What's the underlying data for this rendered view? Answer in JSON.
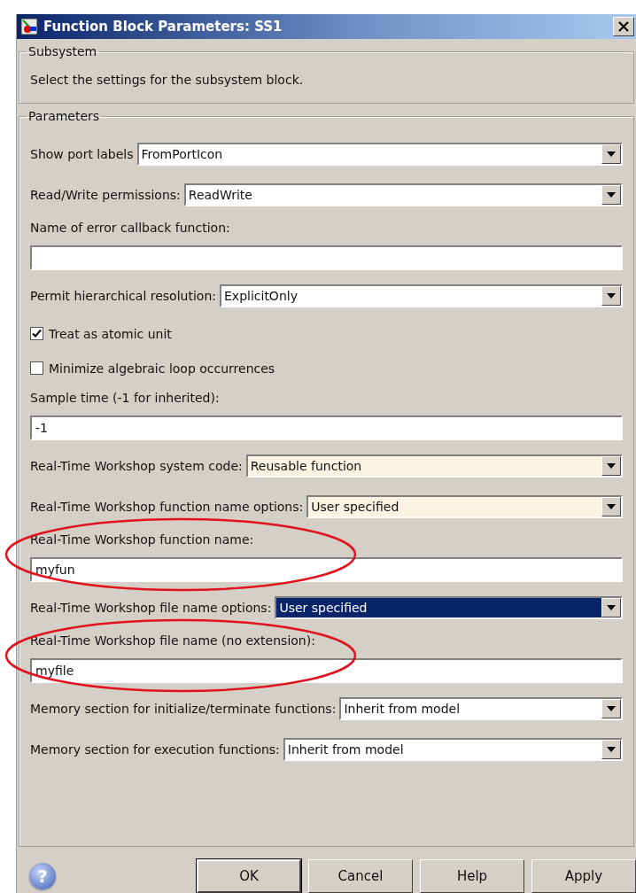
{
  "window": {
    "title": "Function Block Parameters: SS1"
  },
  "subsystem": {
    "legend": "Subsystem",
    "description": "Select the settings for the subsystem block."
  },
  "parameters": {
    "legend": "Parameters",
    "fields": [
      {
        "kind": "combo",
        "label": "Show port labels",
        "value": "FromPortIcon",
        "tinted": false,
        "focused": false
      },
      {
        "kind": "combo",
        "label": "Read/Write permissions:",
        "value": "ReadWrite",
        "tinted": false,
        "focused": false
      },
      {
        "kind": "text",
        "label": "Name of error callback function:",
        "highlighted": false
      },
      {
        "kind": "combo",
        "label": "Permit hierarchical resolution:",
        "value": "ExplicitOnly",
        "tinted": false,
        "focused": false
      },
      {
        "kind": "checkbox",
        "label": "Treat as atomic unit",
        "checked": true
      },
      {
        "kind": "checkbox",
        "label": "Minimize algebraic loop occurrences",
        "checked": false
      },
      {
        "kind": "text",
        "label": "Sample time (-1 for inherited):",
        "value": "-1",
        "highlighted": false
      },
      {
        "kind": "combo",
        "label": "Real-Time Workshop system code:",
        "value": "Reusable function",
        "tinted": true,
        "focused": false
      },
      {
        "kind": "combo",
        "label": "Real-Time Workshop function name options:",
        "value": "User specified",
        "tinted": true,
        "focused": false
      },
      {
        "kind": "text",
        "label": "Real-Time Workshop function name:",
        "value": "myfun",
        "highlighted": true
      },
      {
        "kind": "combo",
        "label": "Real-Time Workshop file name options:",
        "value": "User specified",
        "focused": true
      },
      {
        "kind": "text",
        "label": "Real-Time Workshop file name (no extension):",
        "value": "myfile",
        "highlighted": true
      },
      {
        "kind": "combo",
        "label": "Memory section for initialize/terminate functions:",
        "value": "Inherit from model",
        "tinted": false,
        "focused": false
      },
      {
        "kind": "combo",
        "label": "Memory section for execution functions:",
        "value": "Inherit from model",
        "tinted": false,
        "focused": false
      }
    ]
  },
  "help": {
    "glyph": "?"
  },
  "buttons": [
    {
      "label": "OK",
      "default": true
    },
    {
      "label": "Cancel",
      "default": false
    },
    {
      "label": "Help",
      "default": false
    },
    {
      "label": "Apply",
      "default": false
    }
  ]
}
